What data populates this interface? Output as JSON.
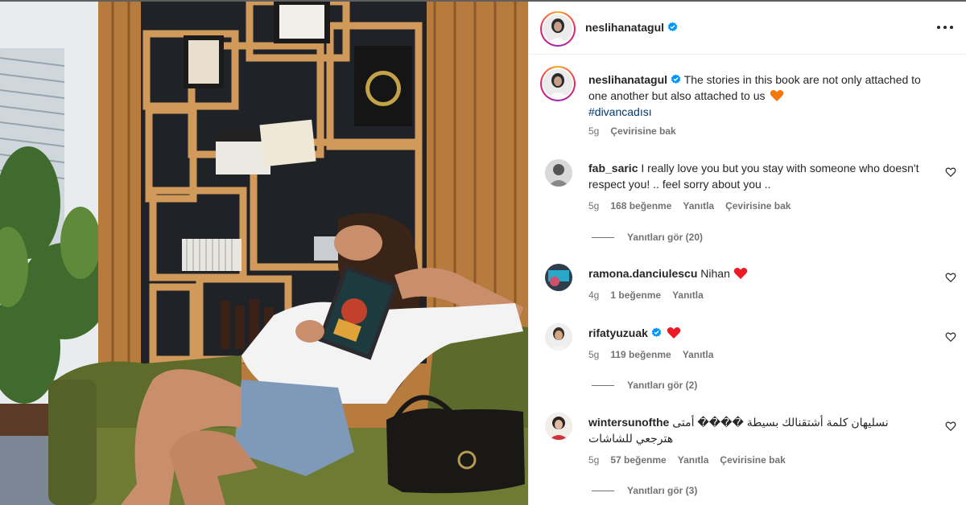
{
  "post": {
    "username": "neslihanatagul",
    "verified": true,
    "caption": "The stories in this book are not only attached to one another but also attached to us",
    "caption_emoji": "orange-heart-icon",
    "hashtag": "#divancadısı",
    "time": "5g",
    "translate": "Çevirisine bak"
  },
  "comments": [
    {
      "username": "fab_saric",
      "verified": false,
      "text": "I really love you but you stay with someone who doesn't respect you! .. feel sorry about you ..",
      "time": "5g",
      "likes": "168 beğenme",
      "reply": "Yanıtla",
      "translate": "Çevirisine bak",
      "view_replies": "Yanıtları gör (20)"
    },
    {
      "username": "ramona.danciulescu",
      "verified": false,
      "text": "Nihan",
      "emoji": "red-heart-icon",
      "time": "4g",
      "likes": "1 beğenme",
      "reply": "Yanıtla"
    },
    {
      "username": "rifatyuzuak",
      "verified": true,
      "text": "",
      "emoji": "red-heart-icon",
      "time": "5g",
      "likes": "119 beğenme",
      "reply": "Yanıtla",
      "view_replies": "Yanıtları gör (2)"
    },
    {
      "username": "wintersunofthe",
      "verified": false,
      "text_line1": "نسليهان كلمة أشتقنالك بسيطة ���� أمتى",
      "text_line2": "هترجعي للشاشات",
      "time": "5g",
      "likes": "57 beğenme",
      "reply": "Yanıtla",
      "translate": "Çevirisine bak",
      "view_replies": "Yanıtları gör (3)"
    }
  ],
  "colors": {
    "verified": "#0095f6",
    "red_heart": "#ed1c24",
    "orange_heart": "#f4780b",
    "hashtag": "#00376b",
    "secondary_text": "#737373"
  },
  "icons": {
    "more": "more-options-icon",
    "like": "heart-outline-icon"
  }
}
